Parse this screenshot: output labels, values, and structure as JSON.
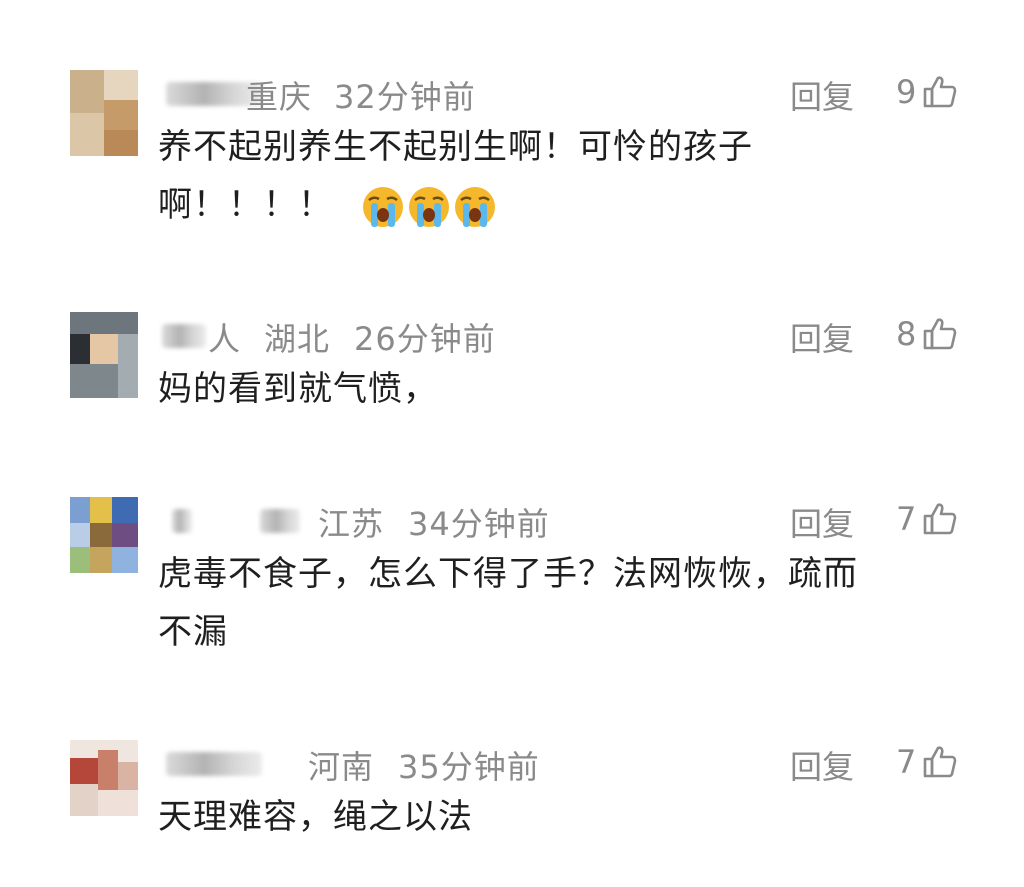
{
  "reply_label": "回复",
  "comments": [
    {
      "name_visible": "重庆",
      "region": "",
      "time": "32分钟前",
      "likes": "9",
      "text_lines": [
        "养不起别养生不起别生啊！可怜的孩子",
        "啊！！！！"
      ],
      "emoji": [
        "loudly-crying-face",
        "loudly-crying-face",
        "loudly-crying-face"
      ]
    },
    {
      "name_visible": "人",
      "region": "湖北",
      "time": "26分钟前",
      "likes": "8",
      "text_lines": [
        "妈的看到就气愤，"
      ]
    },
    {
      "name_visible": "",
      "region": "江苏",
      "time": "34分钟前",
      "likes": "7",
      "text_lines": [
        "虎毒不食子，怎么下得了手？法网恢恢，疏而",
        "不漏"
      ]
    },
    {
      "name_visible": "",
      "region": "河南",
      "time": "35分钟前",
      "likes": "7",
      "text_lines": [
        "天理难容，绳之以法"
      ]
    }
  ],
  "colors": {
    "meta_gray": "#8a8a8a",
    "text": "#1f1f1f",
    "background": "#ffffff"
  }
}
